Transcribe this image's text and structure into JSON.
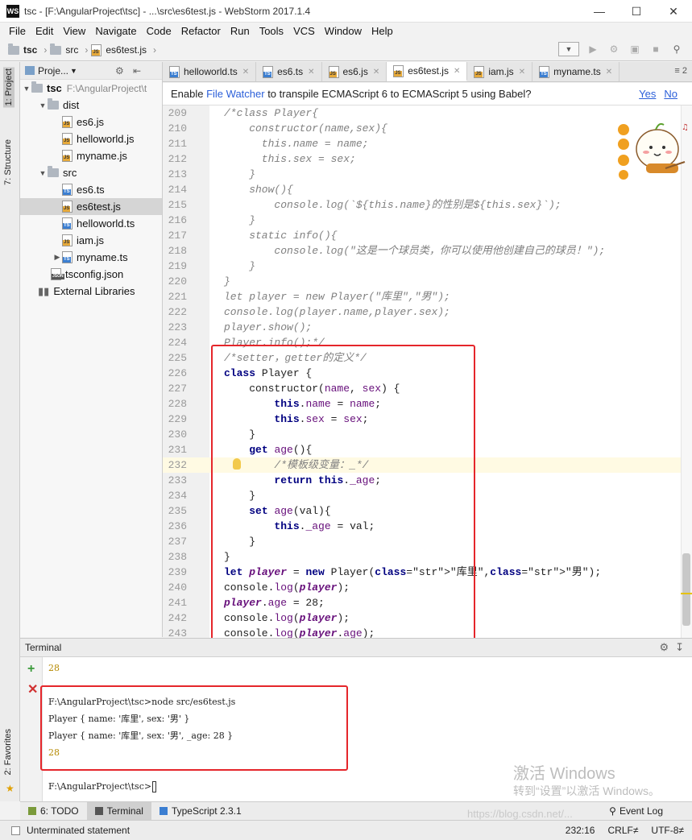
{
  "window": {
    "title": "tsc - [F:\\AngularProject\\tsc] - ...\\src\\es6test.js - WebStorm 2017.1.4",
    "icon_text": "WS",
    "controls": [
      "minimize",
      "maximize",
      "close"
    ]
  },
  "menu": [
    "File",
    "Edit",
    "View",
    "Navigate",
    "Code",
    "Refactor",
    "Run",
    "Tools",
    "VCS",
    "Window",
    "Help"
  ],
  "breadcrumb": [
    "tsc",
    "src",
    "es6test.js"
  ],
  "side_tabs": {
    "project": "1: Project",
    "structure": "7: Structure",
    "favorites": "2: Favorites"
  },
  "project": {
    "header": "Proje...",
    "root": {
      "name": "tsc",
      "path": "F:\\AngularProject\\t"
    },
    "items": [
      {
        "name": "dist",
        "type": "folder",
        "level": 1
      },
      {
        "name": "es6.js",
        "type": "js",
        "level": 2
      },
      {
        "name": "helloworld.js",
        "type": "js",
        "level": 2
      },
      {
        "name": "myname.js",
        "type": "js",
        "level": 2
      },
      {
        "name": "src",
        "type": "folder",
        "level": 1
      },
      {
        "name": "es6.ts",
        "type": "ts",
        "level": 2
      },
      {
        "name": "es6test.js",
        "type": "js",
        "level": 2,
        "selected": true
      },
      {
        "name": "helloworld.ts",
        "type": "ts",
        "level": 2
      },
      {
        "name": "iam.js",
        "type": "js",
        "level": 2
      },
      {
        "name": "myname.ts",
        "type": "ts",
        "level": 2
      },
      {
        "name": "tsconfig.json",
        "type": "json",
        "level": 1
      },
      {
        "name": "External Libraries",
        "type": "lib",
        "level": 0
      }
    ]
  },
  "tabs": [
    {
      "label": "helloworld.ts",
      "type": "ts"
    },
    {
      "label": "es6.ts",
      "type": "ts"
    },
    {
      "label": "es6.js",
      "type": "js"
    },
    {
      "label": "es6test.js",
      "type": "js",
      "active": true
    },
    {
      "label": "iam.js",
      "type": "js"
    },
    {
      "label": "myname.ts",
      "type": "ts"
    }
  ],
  "tabs_more": "≡ 2",
  "notification": {
    "prefix": "Enable ",
    "link": "File Watcher",
    "suffix": " to transpile ECMAScript 6 to ECMAScript 5 using Babel?",
    "yes": "Yes",
    "no": "No"
  },
  "code_lines": [
    {
      "n": "209",
      "t": "/*class Player{"
    },
    {
      "n": "210",
      "t": "    constructor(name,sex){"
    },
    {
      "n": "211",
      "t": "      this.name = name;"
    },
    {
      "n": "212",
      "t": "      this.sex = sex;"
    },
    {
      "n": "213",
      "t": "    }"
    },
    {
      "n": "214",
      "t": "    show(){"
    },
    {
      "n": "215",
      "t": "        console.log(`${this.name}的性别是${this.sex}`);"
    },
    {
      "n": "216",
      "t": "    }"
    },
    {
      "n": "217",
      "t": "    static info(){"
    },
    {
      "n": "218",
      "t": "        console.log(\"这是一个球员类，你可以使用他创建自己的球员！\");"
    },
    {
      "n": "219",
      "t": "    }"
    },
    {
      "n": "220",
      "t": "}"
    },
    {
      "n": "221",
      "t": "let player = new Player(\"库里\",\"男\");"
    },
    {
      "n": "222",
      "t": "console.log(player.name,player.sex);"
    },
    {
      "n": "223",
      "t": "player.show();"
    },
    {
      "n": "224",
      "t": "Player.info();*/"
    },
    {
      "n": "225",
      "t": "/*setter，getter的定义*/"
    },
    {
      "n": "226",
      "t": "class Player {"
    },
    {
      "n": "227",
      "t": "    constructor(name, sex) {"
    },
    {
      "n": "228",
      "t": "        this.name = name;"
    },
    {
      "n": "229",
      "t": "        this.sex = sex;"
    },
    {
      "n": "230",
      "t": "    }"
    },
    {
      "n": "231",
      "t": "    get age(){"
    },
    {
      "n": "232",
      "t": "        /*模板级变量：_*/"
    },
    {
      "n": "233",
      "t": "        return this._age;"
    },
    {
      "n": "234",
      "t": "    }"
    },
    {
      "n": "235",
      "t": "    set age(val){"
    },
    {
      "n": "236",
      "t": "        this._age = val;"
    },
    {
      "n": "237",
      "t": "    }"
    },
    {
      "n": "238",
      "t": "}"
    },
    {
      "n": "239",
      "t": "let player = new Player(\"库里\",\"男\");"
    },
    {
      "n": "240",
      "t": "console.log(player);"
    },
    {
      "n": "241",
      "t": "player.age = 28;"
    },
    {
      "n": "242",
      "t": "console.log(player);"
    },
    {
      "n": "243",
      "t": "console.log(player.age);"
    }
  ],
  "current_line": "232",
  "terminal": {
    "title": "Terminal",
    "lines": [
      "28",
      "F:\\AngularProject\\tsc>node src/es6test.js",
      "Player { name: '库里', sex: '男' }",
      "Player { name: '库里', sex: '男', _age: 28 }",
      "28",
      "F:\\AngularProject\\tsc>"
    ]
  },
  "watermark": {
    "line1": "激活 Windows",
    "line2": "转到“设置”以激活 Windows。",
    "csdn": "https://blog.csdn.net/..."
  },
  "tool_tabs": {
    "todo": "6: TODO",
    "terminal": "Terminal",
    "typescript": "TypeScript 2.3.1",
    "event_log": "Event Log"
  },
  "status": {
    "message": "Unterminated statement",
    "position": "232:16",
    "line_sep": "CRLF≠",
    "encoding": "UTF-8≠"
  },
  "colors": {
    "keyword": "#000080",
    "comment": "#808080",
    "string": "#008000",
    "highlight": "#e5262b",
    "link": "#2b5fd9"
  }
}
